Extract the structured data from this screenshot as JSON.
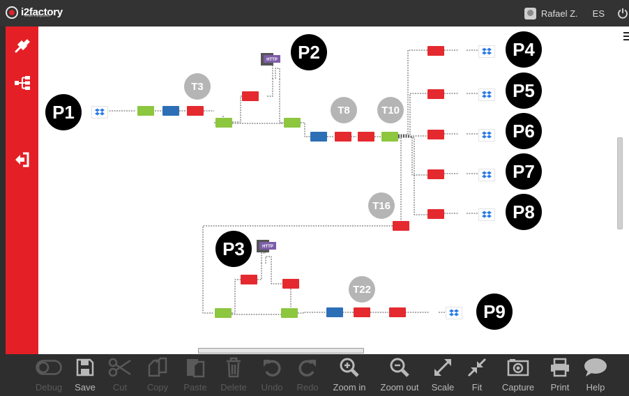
{
  "app": {
    "logo_text": "i2factory",
    "logo_sub": "smart integration"
  },
  "user": {
    "name": "Rafael Z.",
    "language": "ES"
  },
  "sidebar": {
    "items": [
      "connector-icon",
      "flow-tree-icon",
      "logout-icon"
    ]
  },
  "process_labels": [
    "P1",
    "P2",
    "P3",
    "P4",
    "P5",
    "P6",
    "P7",
    "P8",
    "P9"
  ],
  "transform_labels": [
    "T3",
    "T8",
    "T10",
    "T16",
    "T22"
  ],
  "http_label": "HTTP",
  "toolbar": {
    "items": [
      {
        "label": "Debug",
        "enabled": false
      },
      {
        "label": "Save",
        "enabled": true
      },
      {
        "label": "Cut",
        "enabled": false
      },
      {
        "label": "Copy",
        "enabled": false
      },
      {
        "label": "Paste",
        "enabled": false
      },
      {
        "label": "Delete",
        "enabled": false
      },
      {
        "label": "Undo",
        "enabled": false
      },
      {
        "label": "Redo",
        "enabled": false
      },
      {
        "label": "Zoom in",
        "enabled": true
      },
      {
        "label": "Zoom out",
        "enabled": true
      },
      {
        "label": "Scale",
        "enabled": true
      },
      {
        "label": "Fit",
        "enabled": true
      },
      {
        "label": "Capture",
        "enabled": true
      },
      {
        "label": "Print",
        "enabled": true
      },
      {
        "label": "Help",
        "enabled": true
      }
    ]
  },
  "colors": {
    "accent": "#e51f26",
    "node_red": "#e42a2f",
    "node_green": "#8dc63f",
    "node_blue": "#2c6fb7",
    "dropbox": "#2c7be5",
    "toolbar_bg": "#2e2e2e"
  }
}
